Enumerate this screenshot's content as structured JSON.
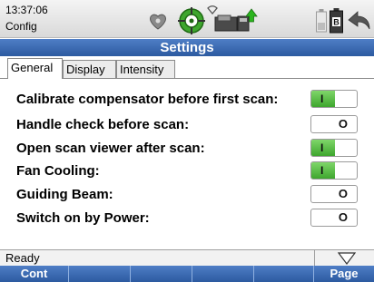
{
  "status_bar": {
    "time": "13:37:06",
    "mode": "Config",
    "icons": [
      "laser-source-icon",
      "target-crosshair-icon",
      "wifi-icon",
      "card-reader-icon",
      "usb-upload-icon",
      "battery-icon",
      "battery-b-icon",
      "back-arrow-icon"
    ]
  },
  "title": "Settings",
  "tabs": [
    {
      "label": "General",
      "active": true
    },
    {
      "label": "Display",
      "active": false
    },
    {
      "label": "Intensity",
      "active": false
    }
  ],
  "settings": [
    {
      "label": "Calibrate compensator before first scan:",
      "state": "on",
      "glyph": "I"
    },
    {
      "label": "Handle check before scan:",
      "state": "off",
      "glyph": "O"
    },
    {
      "label": "Open scan viewer after scan:",
      "state": "on",
      "glyph": "I"
    },
    {
      "label": "Fan Cooling:",
      "state": "on",
      "glyph": "I"
    },
    {
      "label": "Guiding Beam:",
      "state": "off",
      "glyph": "O"
    },
    {
      "label": "Switch on by Power:",
      "state": "off",
      "glyph": "O"
    }
  ],
  "footer": {
    "status": "Ready",
    "softkeys": [
      "Cont",
      "",
      "",
      "",
      "",
      "Page"
    ]
  },
  "colors": {
    "accent_blue": "#2c5aa0",
    "toggle_green": "#3ea62e"
  }
}
